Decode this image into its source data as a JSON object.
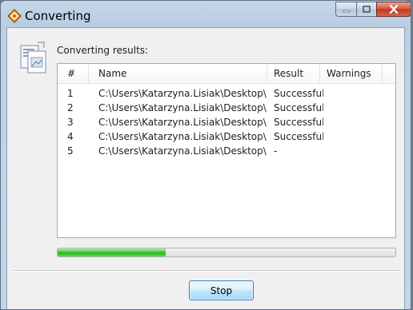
{
  "window": {
    "title": "Converting",
    "controls": {
      "minimize_icon": "minimize-icon",
      "maximize_icon": "maximize-icon",
      "close_icon": "close-icon"
    }
  },
  "main": {
    "heading": "Converting results:",
    "icon": "document-convert-icon",
    "table": {
      "columns": [
        "#",
        "Name",
        "Result",
        "Warnings"
      ],
      "rows": [
        {
          "num": "1",
          "name": "C:\\Users\\Katarzyna.Lisiak\\Desktop\\...",
          "result": "Successful",
          "warnings": ""
        },
        {
          "num": "2",
          "name": "C:\\Users\\Katarzyna.Lisiak\\Desktop\\...",
          "result": "Successful",
          "warnings": ""
        },
        {
          "num": "3",
          "name": "C:\\Users\\Katarzyna.Lisiak\\Desktop\\...",
          "result": "Successful",
          "warnings": ""
        },
        {
          "num": "4",
          "name": "C:\\Users\\Katarzyna.Lisiak\\Desktop\\...",
          "result": "Successful",
          "warnings": ""
        },
        {
          "num": "5",
          "name": "C:\\Users\\Katarzyna.Lisiak\\Desktop\\...",
          "result": "-",
          "warnings": ""
        }
      ]
    },
    "progress": {
      "value": 0.32,
      "color": "#3fd03a"
    }
  },
  "footer": {
    "stop_label": "Stop"
  }
}
